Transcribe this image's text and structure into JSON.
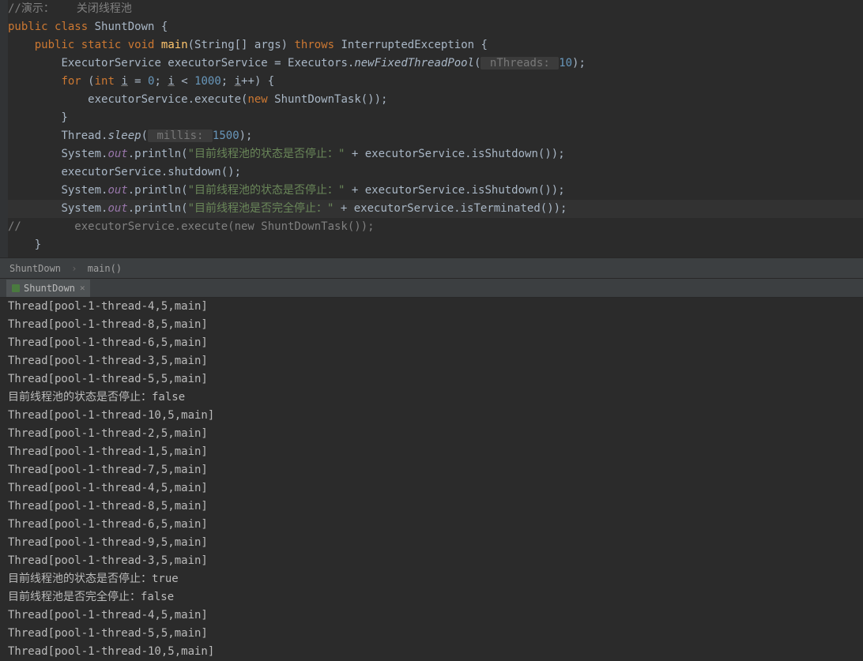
{
  "code": {
    "l1_cmt1": "//演示：",
    "l1_cmt2": "关闭线程池",
    "l2_public": "public ",
    "l2_class": "class ",
    "l2_name": "ShuntDown ",
    "l2_brace": "{",
    "l3_indent": "    ",
    "l3_public": "public ",
    "l3_static": "static ",
    "l3_void": "void ",
    "l3_main": "main",
    "l3_args": "(String[] args) ",
    "l3_throws": "throws ",
    "l3_exc": "InterruptedException {",
    "l4_indent": "        ",
    "l4_text1": "ExecutorService executorService = Executors.",
    "l4_method": "newFixedThreadPool",
    "l4_paren": "(",
    "l4_hint": " nThreads: ",
    "l4_num": "10",
    "l4_end": ");",
    "l5_indent": "        ",
    "l5_for": "for ",
    "l5_p1": "(",
    "l5_int": "int ",
    "l5_i1": "i",
    "l5_eq": " = ",
    "l5_zero": "0",
    "l5_semi1": "; ",
    "l5_i2": "i",
    "l5_lt": " < ",
    "l5_thou": "1000",
    "l5_semi2": "; ",
    "l5_i3": "i",
    "l5_inc": "++) {",
    "l6_indent": "            ",
    "l6_text1": "executorService.execute(",
    "l6_new": "new ",
    "l6_text2": "ShuntDownTask());",
    "l7": "        }",
    "l8_indent": "        ",
    "l8_text1": "Thread.",
    "l8_sleep": "sleep",
    "l8_p": "(",
    "l8_hint": " millis: ",
    "l8_num": "1500",
    "l8_end": ");",
    "l9_indent": "        ",
    "l9_sys": "System.",
    "l9_out": "out",
    "l9_print": ".println(",
    "l9_str": "\"目前线程池的状态是否停止：\"",
    "l9_plus": " + executorService.isShutdown());",
    "l10_indent": "        ",
    "l10_text": "executorService.shutdown();",
    "l11_indent": "        ",
    "l11_sys": "System.",
    "l11_out": "out",
    "l11_print": ".println(",
    "l11_str": "\"目前线程池的状态是否停止：\"",
    "l11_plus": " + executorService.isShutdown());",
    "l12_indent": "        ",
    "l12_sys": "System.",
    "l12_out": "out",
    "l12_print": ".println(",
    "l12_str": "\"目前线程池是否完全停止：\"",
    "l12_plus": " + executorService.isTerminated());",
    "l13_cmt": "//        executorService.execute(new ShuntDownTask());",
    "l14": "    }"
  },
  "breadcrumb": {
    "class": "ShuntDown",
    "method": "main()"
  },
  "console_tab": {
    "name": "ShuntDown"
  },
  "console": {
    "lines": [
      "Thread[pool-1-thread-4,5,main]",
      "Thread[pool-1-thread-8,5,main]",
      "Thread[pool-1-thread-6,5,main]",
      "Thread[pool-1-thread-3,5,main]",
      "Thread[pool-1-thread-5,5,main]",
      "目前线程池的状态是否停止：false",
      "Thread[pool-1-thread-10,5,main]",
      "Thread[pool-1-thread-2,5,main]",
      "Thread[pool-1-thread-1,5,main]",
      "Thread[pool-1-thread-7,5,main]",
      "Thread[pool-1-thread-4,5,main]",
      "Thread[pool-1-thread-8,5,main]",
      "Thread[pool-1-thread-6,5,main]",
      "Thread[pool-1-thread-9,5,main]",
      "Thread[pool-1-thread-3,5,main]",
      "目前线程池的状态是否停止：true",
      "目前线程池是否完全停止：false",
      "Thread[pool-1-thread-4,5,main]",
      "Thread[pool-1-thread-5,5,main]",
      "Thread[pool-1-thread-10,5,main]"
    ]
  }
}
